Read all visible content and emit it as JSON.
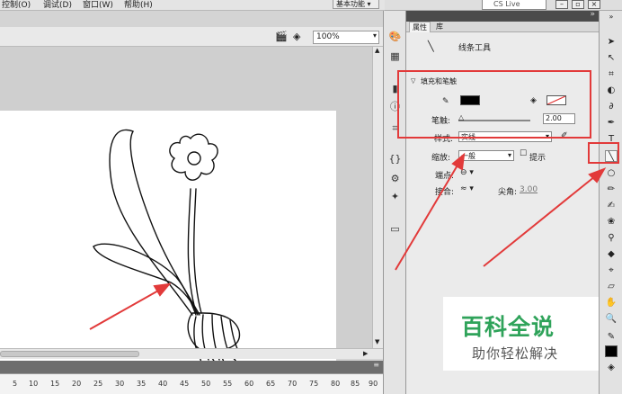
{
  "menu": {
    "items": [
      "控制(O)",
      "调试(D)",
      "窗口(W)",
      "帮助(H)"
    ],
    "workspace": "基本功能",
    "search": "CS Live"
  },
  "stage": {
    "zoom": "100%"
  },
  "timeline": {
    "ruler_ticks": [
      "5",
      "10",
      "15",
      "20",
      "25",
      "30",
      "35",
      "40",
      "45",
      "50",
      "55",
      "60",
      "65",
      "70",
      "75",
      "80",
      "85",
      "90"
    ]
  },
  "panel": {
    "tab_properties": "属性",
    "tab_library": "库",
    "tool_name": "线条工具",
    "section_fill_stroke": "填充和笔触",
    "stroke_label": "笔触:",
    "stroke_value": "2.00",
    "style_label": "样式:",
    "style_value": "实线",
    "scale_label": "缩放:",
    "scale_value": "一般",
    "hint_label": "提示",
    "cap_label": "端点:",
    "join_label": "接合:",
    "miter_label": "尖角:",
    "miter_value": "3.00",
    "stroke_color": "#000000"
  },
  "watermark": {
    "title": "百科全说",
    "subtitle": "助你轻松解决"
  },
  "colors": {
    "annotation_red": "#e23a3a",
    "watermark_green": "#2fa35a"
  }
}
